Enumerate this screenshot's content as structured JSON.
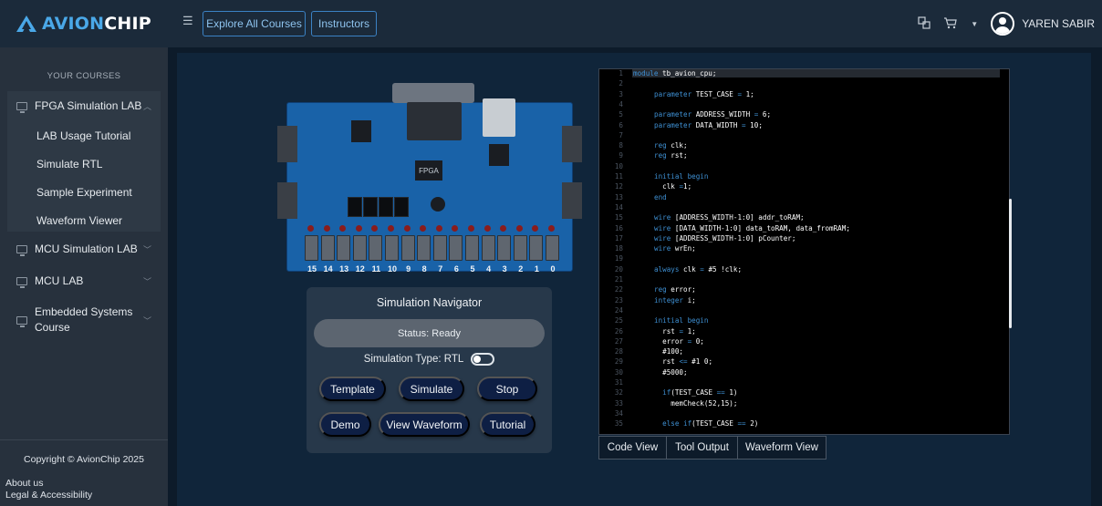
{
  "header": {
    "brand": "AVIONCHIP",
    "brand_left": "AVION",
    "brand_right": "CHIP",
    "nav": {
      "explore": "Explore All Courses",
      "instructors": "Instructors"
    },
    "user": {
      "name": "YAREN SABIR"
    },
    "icons": [
      "menu-icon",
      "language-icon",
      "cart-icon",
      "chevron-down-icon",
      "user-avatar-icon"
    ]
  },
  "sidebar": {
    "heading": "YOUR COURSES",
    "fpga": {
      "label": "FPGA Simulation LAB",
      "items": [
        "LAB Usage Tutorial",
        "Simulate RTL",
        "Sample Experiment",
        "Waveform Viewer"
      ]
    },
    "mcu_sim": "MCU Simulation LAB",
    "mcu_lab": "MCU LAB",
    "embedded_line1": "Embedded Systems",
    "embedded_line2": "Course",
    "copyright": "Copyright © AvionChip 2025",
    "about": "About us",
    "legal": "Legal & Accessibility"
  },
  "board": {
    "fpga_label": "FPGA",
    "switch_numbers": [
      "15",
      "14",
      "13",
      "12",
      "11",
      "10",
      "9",
      "8",
      "7",
      "6",
      "5",
      "4",
      "3",
      "2",
      "1",
      "0"
    ]
  },
  "navigator": {
    "title": "Simulation Navigator",
    "status": "Status: Ready",
    "sim_type": "Simulation Type: RTL",
    "buttons": {
      "template": "Template",
      "simulate": "Simulate",
      "stop": "Stop",
      "demo": "Demo",
      "view_waveform": "View Waveform",
      "tutorial": "Tutorial"
    }
  },
  "editor": {
    "lines": [
      [
        [
          "k",
          "module"
        ],
        [
          "t",
          " tb_avion_cpu;"
        ]
      ],
      [],
      [
        [
          "k",
          "parameter"
        ],
        [
          "t",
          " TEST_CASE "
        ],
        [
          "k",
          "="
        ],
        [
          "t",
          " 1;"
        ]
      ],
      [],
      [
        [
          "k",
          "parameter"
        ],
        [
          "t",
          " ADDRESS_WIDTH "
        ],
        [
          "k",
          "="
        ],
        [
          "t",
          " 6;"
        ]
      ],
      [
        [
          "k",
          "parameter"
        ],
        [
          "t",
          " DATA_WIDTH "
        ],
        [
          "k",
          "="
        ],
        [
          "t",
          " 10;"
        ]
      ],
      [],
      [
        [
          "k",
          "reg"
        ],
        [
          "t",
          " clk;"
        ]
      ],
      [
        [
          "k",
          "reg"
        ],
        [
          "t",
          " rst;"
        ]
      ],
      [],
      [
        [
          "k",
          "initial begin"
        ]
      ],
      [
        [
          "t",
          "  clk "
        ],
        [
          "k",
          "="
        ],
        [
          "t",
          "1;"
        ]
      ],
      [
        [
          "k",
          "end"
        ]
      ],
      [],
      [
        [
          "k",
          "wire"
        ],
        [
          "t",
          " [ADDRESS_WIDTH-1:0] addr_toRAM;"
        ]
      ],
      [
        [
          "k",
          "wire"
        ],
        [
          "t",
          " [DATA_WIDTH-1:0] data_toRAM, data_fromRAM;"
        ]
      ],
      [
        [
          "k",
          "wire"
        ],
        [
          "t",
          " [ADDRESS_WIDTH-1:0] pCounter;"
        ]
      ],
      [
        [
          "k",
          "wire"
        ],
        [
          "t",
          " wrEn;"
        ]
      ],
      [],
      [
        [
          "k",
          "always"
        ],
        [
          "t",
          " clk "
        ],
        [
          "k",
          "="
        ],
        [
          "t",
          " #5 !clk;"
        ]
      ],
      [],
      [
        [
          "k",
          "reg"
        ],
        [
          "t",
          " error;"
        ]
      ],
      [
        [
          "k",
          "integer"
        ],
        [
          "t",
          " i;"
        ]
      ],
      [],
      [
        [
          "k",
          "initial begin"
        ]
      ],
      [
        [
          "t",
          "  rst "
        ],
        [
          "k",
          "="
        ],
        [
          "t",
          " 1;"
        ]
      ],
      [
        [
          "t",
          "  error "
        ],
        [
          "k",
          "="
        ],
        [
          "t",
          " 0;"
        ]
      ],
      [
        [
          "t",
          "  #100;"
        ]
      ],
      [
        [
          "t",
          "  rst "
        ],
        [
          "k",
          "<="
        ],
        [
          "t",
          " #1 0;"
        ]
      ],
      [
        [
          "t",
          "  #5000;"
        ]
      ],
      [],
      [
        [
          "t",
          "  "
        ],
        [
          "k",
          "if"
        ],
        [
          "t",
          "(TEST_CASE "
        ],
        [
          "k",
          "=="
        ],
        [
          "t",
          " 1)"
        ]
      ],
      [
        [
          "t",
          "    memCheck(52,15);"
        ]
      ],
      [],
      [
        [
          "t",
          "  "
        ],
        [
          "k",
          "else if"
        ],
        [
          "t",
          "(TEST_CASE "
        ],
        [
          "k",
          "=="
        ],
        [
          "t",
          " 2)"
        ]
      ]
    ],
    "indents": [
      0,
      0,
      1,
      0,
      1,
      1,
      0,
      1,
      1,
      0,
      1,
      1,
      1,
      0,
      1,
      1,
      1,
      1,
      0,
      1,
      0,
      1,
      1,
      0,
      1,
      1,
      1,
      1,
      1,
      1,
      0,
      1,
      1,
      0,
      1
    ]
  },
  "tabs": [
    "Code View",
    "Tool Output",
    "Waveform View"
  ]
}
